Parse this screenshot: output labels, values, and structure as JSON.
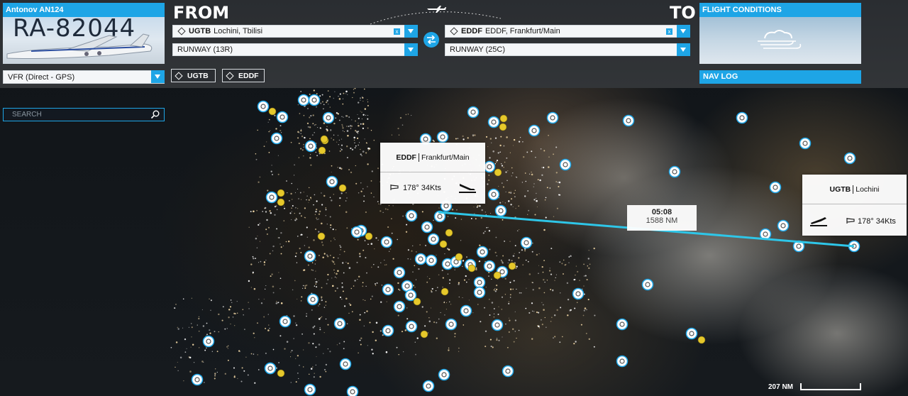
{
  "aircraft": {
    "name": "Antonov AN124",
    "registration": "RA-82044"
  },
  "departure": {
    "heading": "FROM",
    "icao": "UGTB",
    "airport_name": "Lochini, Tbilisi",
    "runway": "RUNWAY (13R)",
    "card_name": "Lochini",
    "wind": "178° 34Kts"
  },
  "arrival": {
    "heading": "TO",
    "icao": "EDDF",
    "airport_name": "EDDF, Frankfurt/Main",
    "runway": "RUNWAY (25C)",
    "card_name": "Frankfurt/Main",
    "wind": "178° 34Kts"
  },
  "flight_conditions": {
    "title": "FLIGHT CONDITIONS",
    "weather_icon": "cloudy-wind-icon"
  },
  "flight_plan": {
    "type": "VFR (Direct - GPS)"
  },
  "waypoint_chips": [
    "UGTB",
    "EDDF"
  ],
  "nav_log": {
    "label": "NAV LOG"
  },
  "search": {
    "placeholder": "SEARCH"
  },
  "route": {
    "time": "05:08",
    "distance": "1588 NM",
    "line_color": "#2ec6e8"
  },
  "map_scale": {
    "label": "207 NM"
  },
  "colors": {
    "accent": "#1ea5e6",
    "airport_marker": "#ffffff",
    "poi_marker": "#e6c82b"
  }
}
